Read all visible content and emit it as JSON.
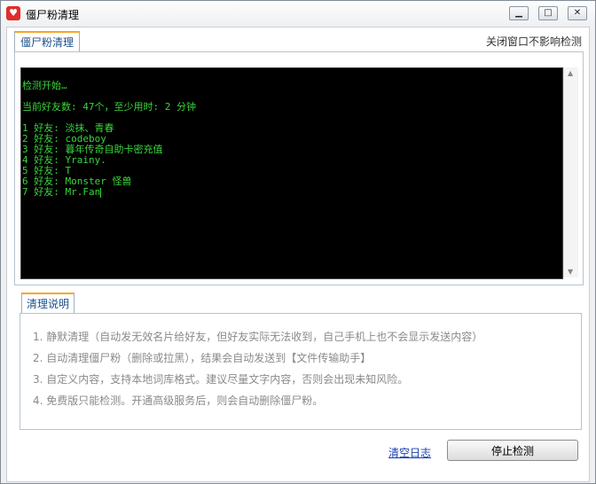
{
  "window": {
    "title": "僵尸粉清理",
    "app_icon": "heart-app-icon",
    "controls": {
      "minimize": "minimize-icon",
      "maximize": "maximize-icon",
      "close": "close-icon"
    }
  },
  "detection_tab": {
    "label": "僵尸粉清理",
    "notice": "关闭窗口不影响检测"
  },
  "console": {
    "start_line": "检测开始…",
    "summary_line": "当前好友数: 47个，至少用时: 2 分钟",
    "friends": [
      "1 好友: 淡抹、青春",
      "2 好友: codeboy",
      "3 好友: 暮年传奇自助卡密充值",
      "4 好友: Yrainy.",
      "5 好友: T",
      "6 好友: Monster 怪兽",
      "7 好友: Mr.Fan"
    ]
  },
  "instructions_tab": {
    "label": "清理说明",
    "items": [
      "1.  静默清理（自动发无效名片给好友，但好友实际无法收到，自己手机上也不会显示发送内容）",
      "2.  自动清理僵尸粉（删除或拉黑），结果会自动发送到【文件传输助手】",
      "3.  自定义内容，支持本地词库格式。建议尽量文字内容，否则会出现未知风险。",
      "4.  免费版只能检测。开通高级服务后，则会自动删除僵尸粉。"
    ]
  },
  "footer": {
    "clear_log_label": "清空日志",
    "stop_button_label": "停止检测"
  }
}
